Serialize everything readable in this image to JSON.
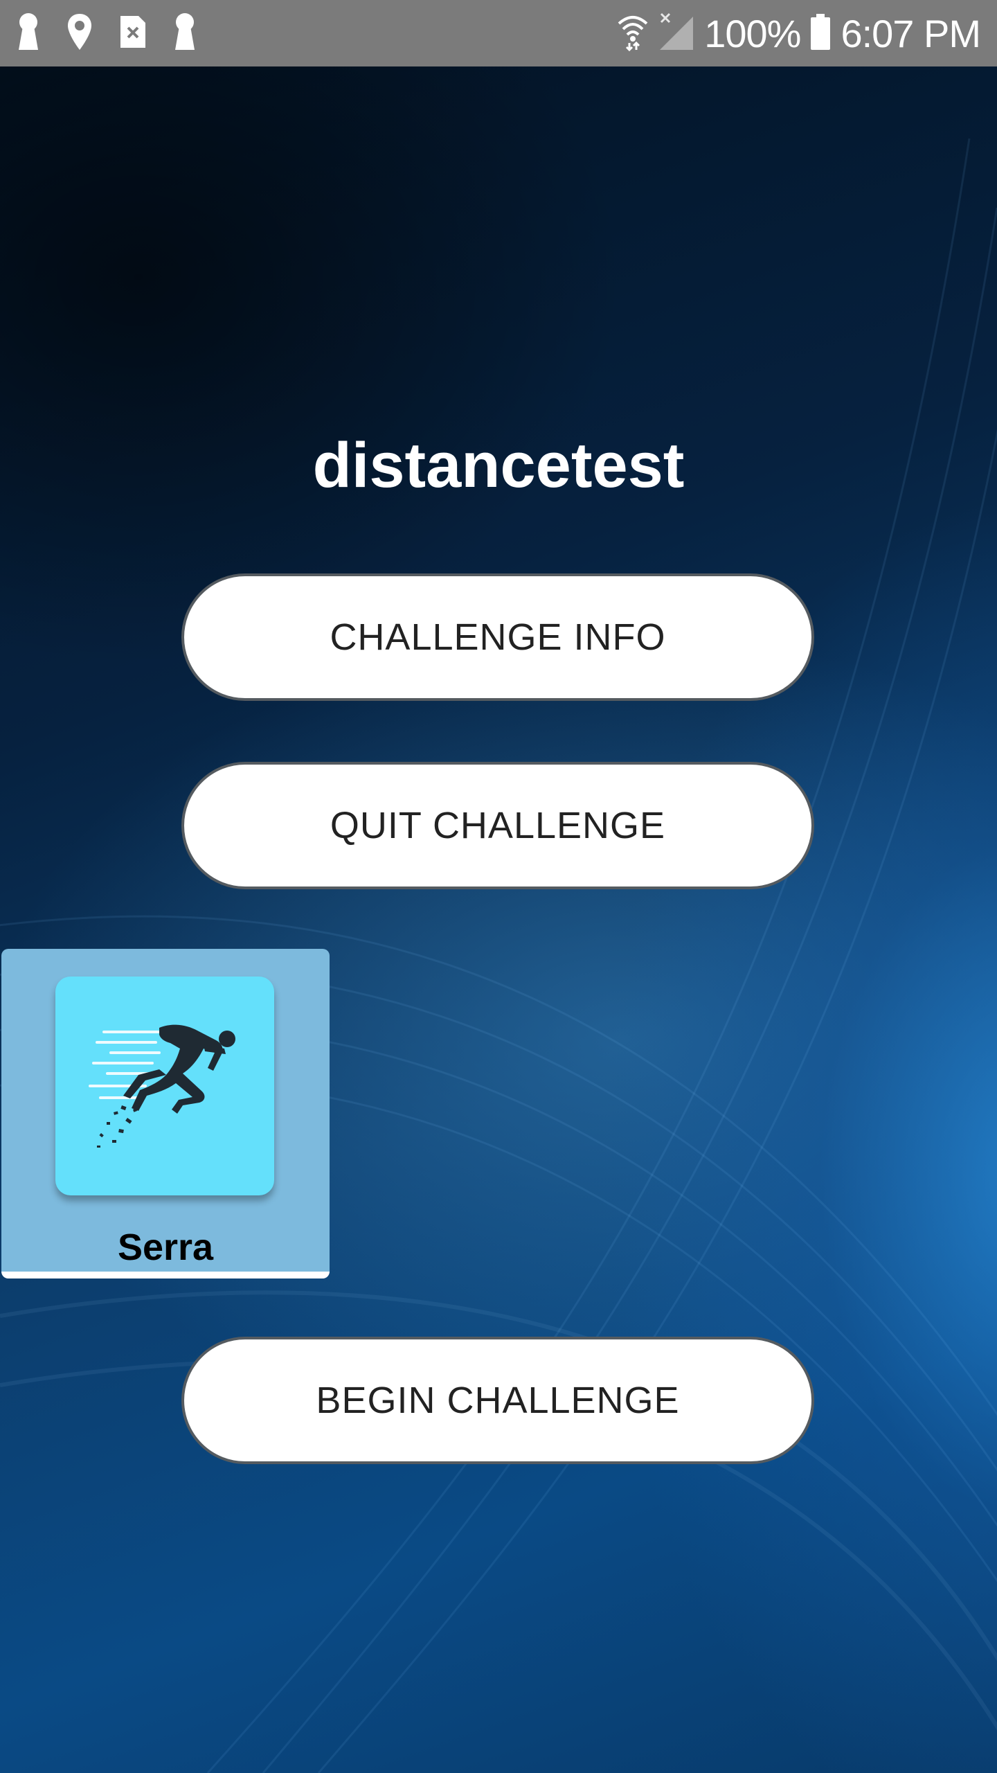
{
  "status_bar": {
    "battery": "100%",
    "time": "6:07 PM",
    "left_icons": [
      "keyhole-icon",
      "location-pin-icon",
      "sim-card-icon",
      "keyhole-icon"
    ],
    "right_icons": [
      "wifi-icon",
      "cellular-signal-icon",
      "battery-icon"
    ]
  },
  "challenge": {
    "title": "distancetest"
  },
  "buttons": {
    "challenge_info": "CHALLENGE INFO",
    "quit_challenge": "QUIT CHALLENGE",
    "begin_challenge": "BEGIN CHALLENGE"
  },
  "participant": {
    "name": "Serra",
    "icon": "runner-icon"
  },
  "colors": {
    "status_bar": "#7b7b7b",
    "card_background": "#7dbadd",
    "card_icon_background": "#64e0fb",
    "button_background": "#ffffff",
    "button_border": "#555b60"
  }
}
